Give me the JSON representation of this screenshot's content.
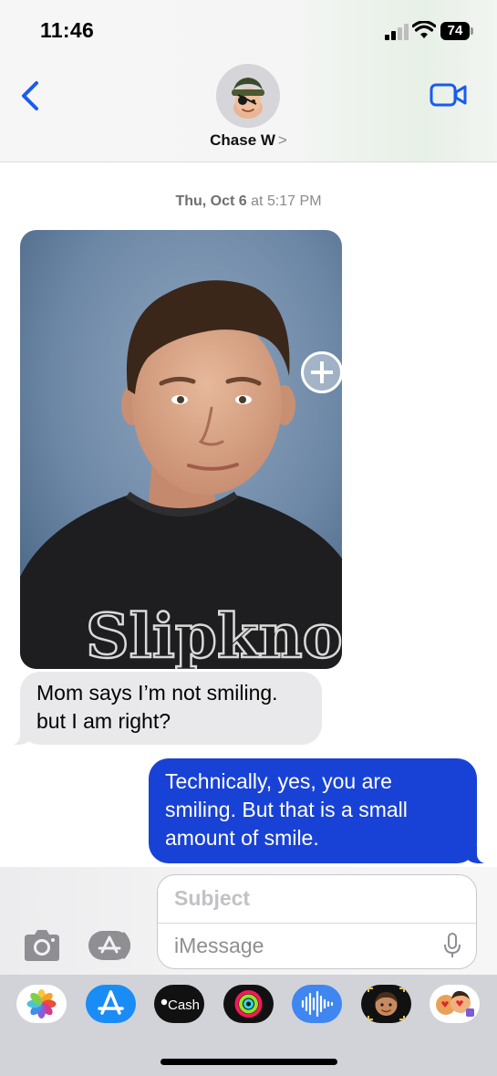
{
  "status_bar": {
    "time": "11:46",
    "battery": "74"
  },
  "header": {
    "contact_name": "Chase W",
    "contact_chevron": ">"
  },
  "conversation": {
    "timestamp_day": "Thu, Oct 6",
    "timestamp_at": " at ",
    "timestamp_time": "5:17 PM",
    "photo_shirt_text": "Slipknot",
    "incoming_message": "Mom says I’m not smiling. but I am right?",
    "outgoing_message": "Technically, yes, you are smiling. But that is a small amount of smile."
  },
  "compose": {
    "subject_placeholder": "Subject",
    "message_placeholder": "iMessage"
  },
  "app_drawer": {
    "items": [
      {
        "name": "photos",
        "icon": "photos-icon"
      },
      {
        "name": "app-store",
        "icon": "app-store-icon"
      },
      {
        "name": "apple-cash",
        "icon": "cash-icon",
        "label": "Cash"
      },
      {
        "name": "fitness",
        "icon": "activity-rings-icon"
      },
      {
        "name": "audio-message",
        "icon": "waveform-icon"
      },
      {
        "name": "memoji",
        "icon": "memoji-icon"
      },
      {
        "name": "memoji-stickers",
        "icon": "memoji-stickers-icon"
      }
    ]
  },
  "colors": {
    "accent": "#1842d6",
    "incoming_bubble": "#e9e9eb",
    "outgoing_bubble": "#1842d6",
    "ios_blue": "#1a5bf0"
  }
}
